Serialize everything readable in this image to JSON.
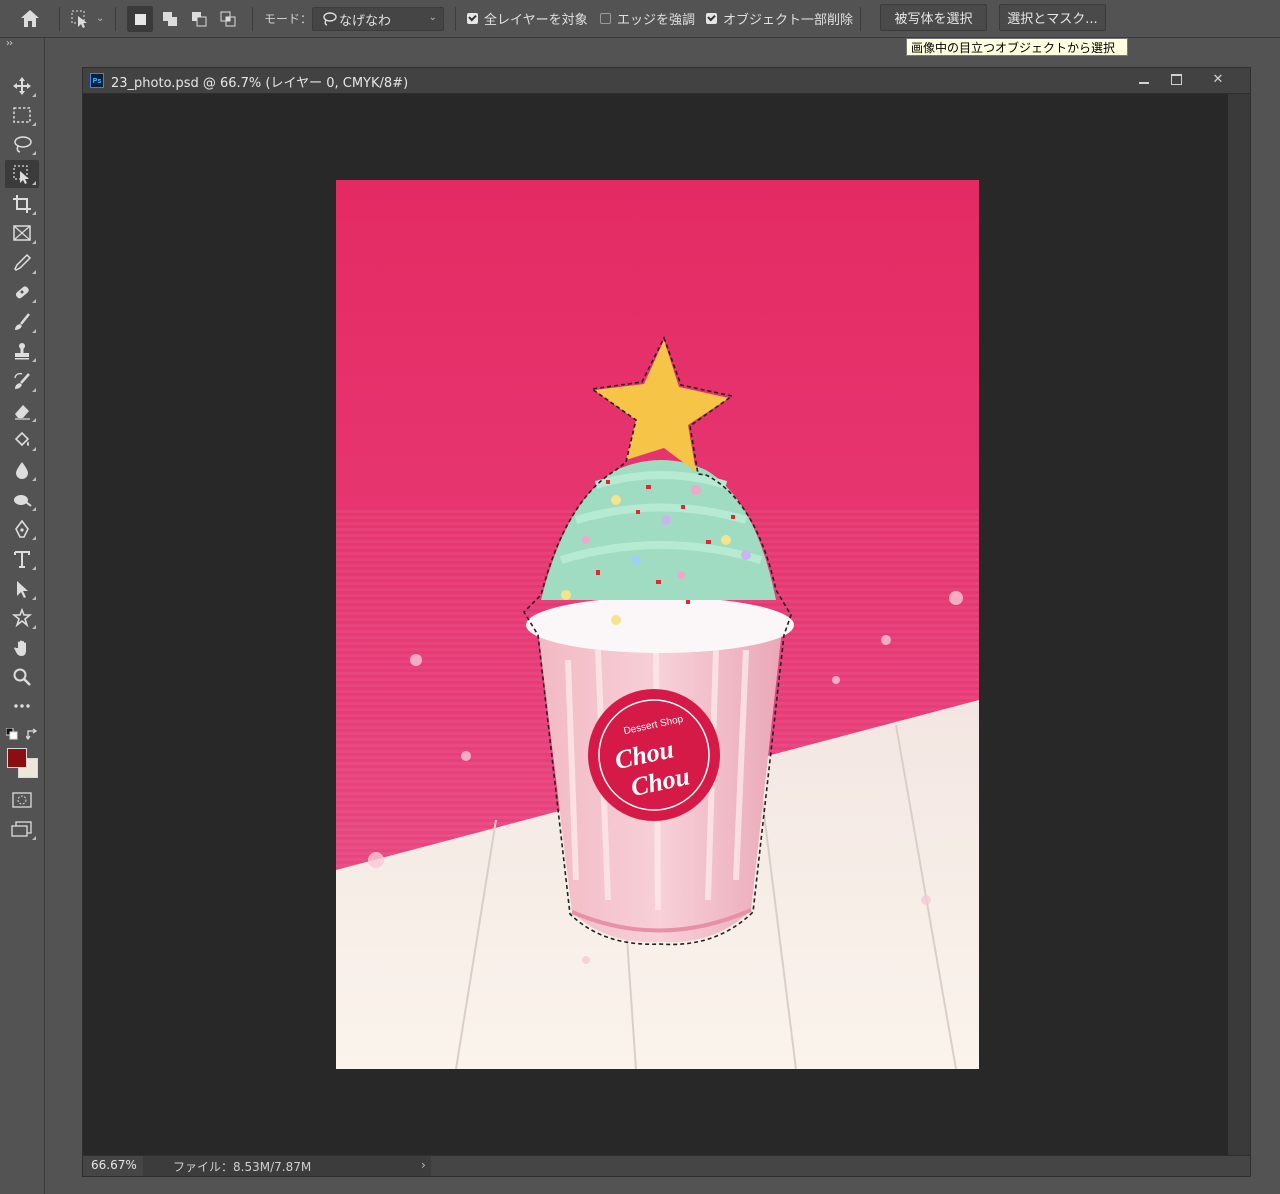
{
  "options_bar": {
    "mode_label": "モード：",
    "mode_value": "なげなわ",
    "checkbox_all_layers": "全レイヤーを対象",
    "checkbox_enhance_edge": "エッジを強調",
    "checkbox_object_subtract": "オブジェクト一部削除",
    "checks": {
      "all_layers": true,
      "enhance_edge": false,
      "object_subtract": true
    },
    "select_subject_button": "被写体を選択",
    "select_mask_button": "選択とマスク...",
    "tooltip": "画像中の目立つオブジェクトから選択"
  },
  "document": {
    "title": "23_photo.psd @ 66.7% (レイヤー 0, CMYK/8#)",
    "zoom": "66.67%",
    "file_info": "ファイル：8.53M/7.87M"
  },
  "photo": {
    "logo_line1": "Chou",
    "logo_line2": "Chou",
    "logo_arc": "Dessert Shop"
  },
  "colors": {
    "foreground": "#8a0f12",
    "background": "#ede6da"
  },
  "toolbar_icons": [
    "move-icon",
    "marquee-icon",
    "lasso-icon",
    "object-selection-icon",
    "crop-icon",
    "frame-icon",
    "eyedropper-icon",
    "healing-brush-icon",
    "brush-icon",
    "stamp-icon",
    "history-brush-icon",
    "eraser-icon",
    "paint-bucket-icon",
    "blur-icon",
    "dodge-icon",
    "pen-icon",
    "type-icon",
    "path-selection-icon",
    "shape-icon",
    "hand-icon",
    "zoom-icon",
    "more-tools-icon"
  ]
}
